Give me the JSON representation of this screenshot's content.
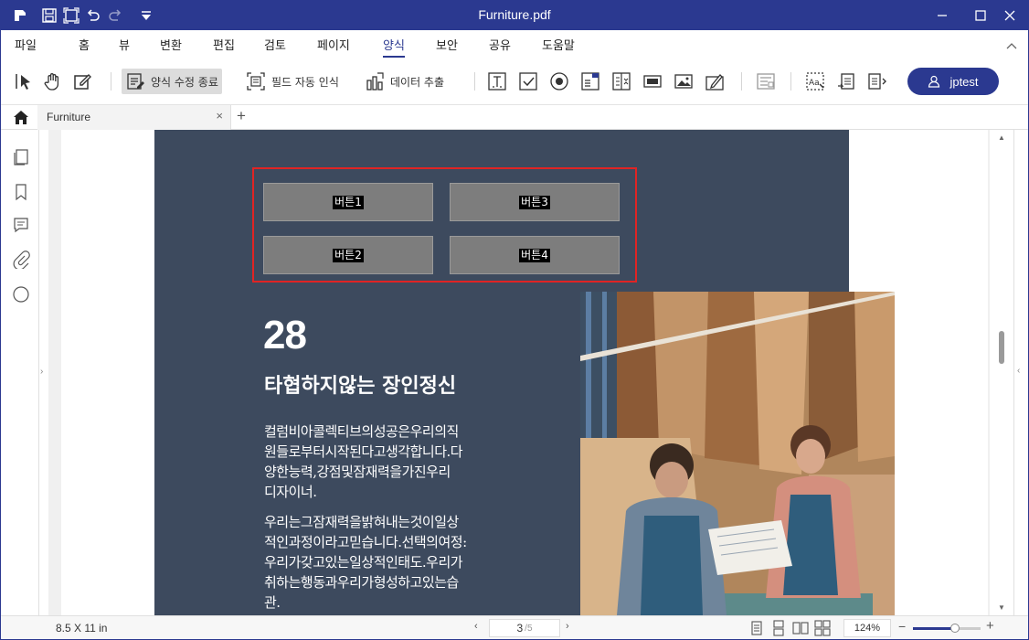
{
  "window": {
    "title": "Furniture.pdf"
  },
  "menu": {
    "items": [
      {
        "label": "파일"
      },
      {
        "label": "홈"
      },
      {
        "label": "뷰"
      },
      {
        "label": "변환"
      },
      {
        "label": "편집"
      },
      {
        "label": "검토"
      },
      {
        "label": "페이지"
      },
      {
        "label": "양식"
      },
      {
        "label": "보안"
      },
      {
        "label": "공유"
      },
      {
        "label": "도움말"
      }
    ],
    "active": "양식"
  },
  "toolbar": {
    "form_edit_close": "양식 수정 종료",
    "field_auto_detect": "필드 자동 인식",
    "data_extract": "데이터 추출",
    "user": "jptest"
  },
  "tabs": [
    {
      "label": "Furniture"
    }
  ],
  "document": {
    "buttons": [
      "버튼1",
      "버튼3",
      "버튼2",
      "버튼4"
    ],
    "number": "28",
    "heading": "타협하지않는 장인정신",
    "paragraph1_lines": [
      "컬럼비아콜렉티브의성공은우리의직",
      "원들로부터시작된다고생각합니다.다",
      "양한능력,강점및잠재력을가진우리",
      "디자이너."
    ],
    "paragraph2_lines": [
      "우리는그잠재력을밝혀내는것이일상",
      "적인과정이라고믿습니다.선택의여정:",
      "우리가갖고있는일상적인태도.우리가",
      "취하는행동과우리가형성하고있는습",
      "관."
    ]
  },
  "status": {
    "page_size": "8.5 X 11 in",
    "current_page": "3",
    "total_pages": "/5",
    "zoom": "124%",
    "zoom_fraction": 0.62
  },
  "colors": {
    "accent": "#2b3990",
    "panel": "#3d4a5e",
    "field_border": "#e02424"
  }
}
